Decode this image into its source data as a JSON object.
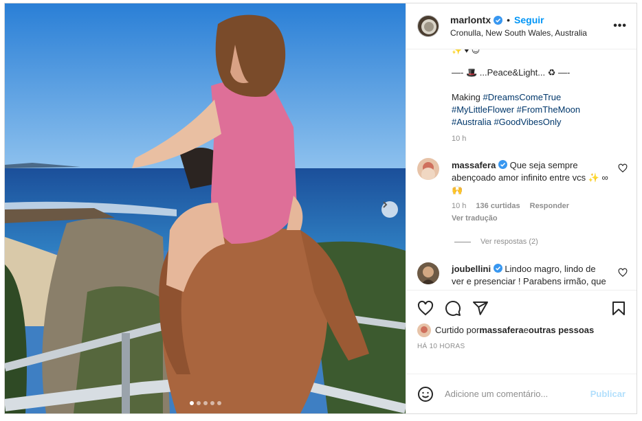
{
  "post": {
    "username": "marlontx",
    "follow_label": "Seguir",
    "location": "Cronulla, New South Wales, Australia",
    "more_icon": "more-options-icon",
    "carousel": {
      "total_slides": 5,
      "active_slide": 1
    }
  },
  "caption": {
    "emoji_line": "✨ ♥ 😊",
    "peace_line": "—- 🎩 ...Peace&Light... ♻ —-",
    "making": "Making ",
    "tags": [
      "#DreamsComeTrue",
      "#MyLittleFlower",
      "#FromTheMoon",
      "#Australia",
      "#GoodVibesOnly"
    ],
    "time": "10 h"
  },
  "comments": [
    {
      "user": "massafera",
      "text": "Que seja sempre abençoado amor infinito entre vcs ✨ ∞ 🙌",
      "time": "10 h",
      "likes": "136 curtidas",
      "reply": "Responder",
      "translate": "Ver tradução",
      "view_replies": "Ver respostas (2)"
    },
    {
      "user": "joubellini",
      "text": "Lindoo magro, lindo de ver e presenciar ! Parabens irmão, que a Luz continue brilhando dessa"
    }
  ],
  "likes_line": {
    "prefix": "Curtido por ",
    "user": "massafera",
    "joiner": " e ",
    "others": "outras pessoas"
  },
  "timestamp": "HÁ 10 HORAS",
  "add_comment": {
    "placeholder": "Adicione um comentário...",
    "publish_label": "Publicar"
  },
  "colors": {
    "accent": "#0095f6",
    "hashtag": "#00376b",
    "muted": "#8e8e8e",
    "publish_disabled": "#b2dffc"
  }
}
